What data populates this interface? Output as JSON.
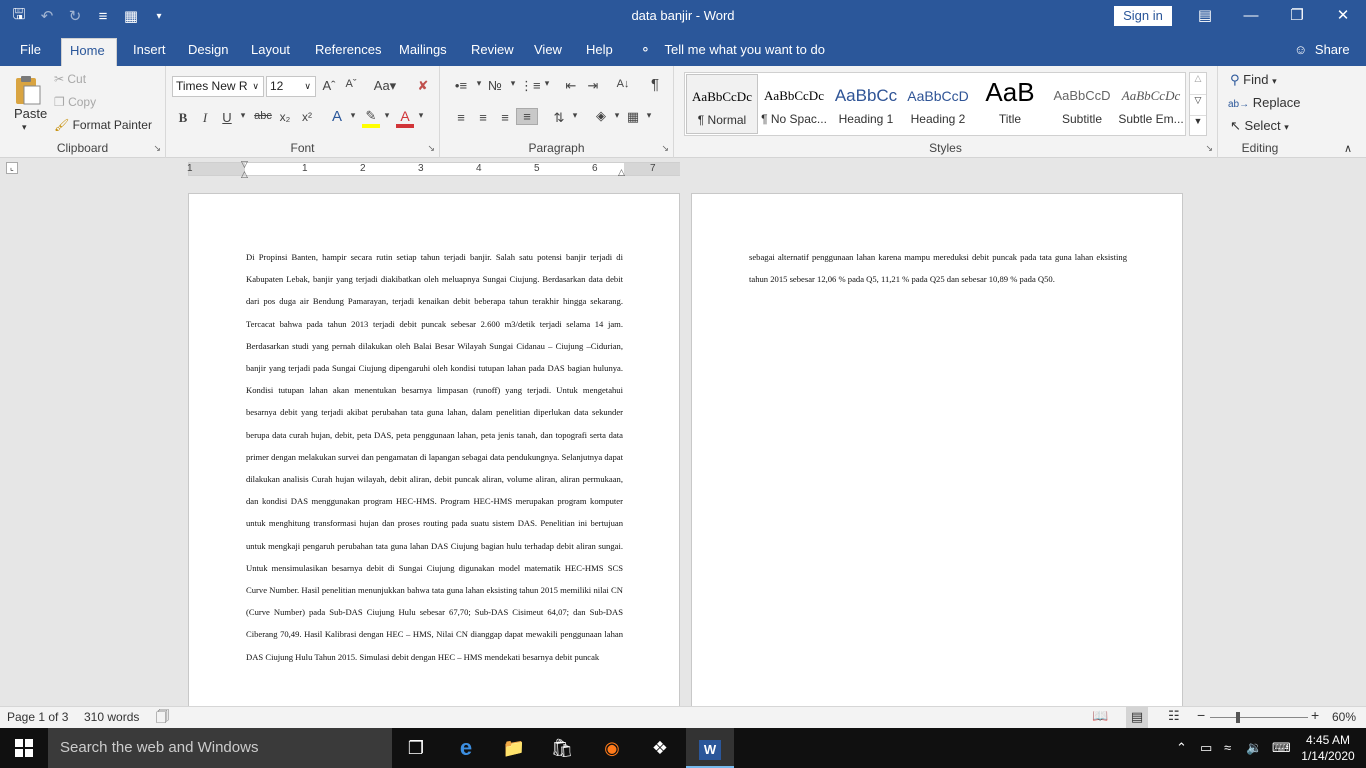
{
  "window": {
    "title": "data banjir  -  Word",
    "sign_in": "Sign in"
  },
  "ribbon_tabs": [
    "File",
    "Home",
    "Insert",
    "Design",
    "Layout",
    "References",
    "Mailings",
    "Review",
    "View",
    "Help"
  ],
  "tell_me": "Tell me what you want to do",
  "share": "Share",
  "clipboard": {
    "paste": "Paste",
    "cut": "Cut",
    "copy": "Copy",
    "format_painter": "Format Painter",
    "label": "Clipboard"
  },
  "font": {
    "name": "Times New R",
    "size": "12",
    "label": "Font"
  },
  "paragraph": {
    "label": "Paragraph"
  },
  "styles": {
    "label": "Styles",
    "items": [
      {
        "preview": "AaBbCcDc",
        "name": "¶ Normal"
      },
      {
        "preview": "AaBbCcDc",
        "name": "¶ No Spac..."
      },
      {
        "preview": "AaBbCc",
        "name": "Heading 1"
      },
      {
        "preview": "AaBbCcD",
        "name": "Heading 2"
      },
      {
        "preview": "AaB",
        "name": "Title"
      },
      {
        "preview": "AaBbCcD",
        "name": "Subtitle"
      },
      {
        "preview": "AaBbCcDc",
        "name": "Subtle Em..."
      }
    ]
  },
  "editing": {
    "find": "Find",
    "replace": "Replace",
    "select": "Select",
    "label": "Editing"
  },
  "ruler_numbers": [
    "1",
    "1",
    "2",
    "3",
    "4",
    "5",
    "6",
    "7"
  ],
  "document": {
    "page1_text": "Di Propinsi Banten, hampir secara rutin setiap tahun terjadi banjir. Salah satu potensi banjir terjadi di Kabupaten Lebak, banjir yang terjadi diakibatkan oleh meluapnya Sungai Ciujung. Berdasarkan data debit dari pos duga air Bendung Pamarayan, terjadi kenaikan debit beberapa tahun terakhir hingga sekarang. Tercacat bahwa pada tahun 2013 terjadi debit puncak sebesar 2.600 m3/detik terjadi selama 14 jam. Berdasarkan studi yang pernah dilakukan oleh Balai Besar Wilayah Sungai Cidanau – Ciujung –Cidurian, banjir yang terjadi pada Sungai Ciujung dipengaruhi oleh kondisi tutupan lahan pada DAS bagian hulunya. Kondisi tutupan lahan akan menentukan besarnya limpasan (runoff) yang terjadi.  Untuk mengetahui besarnya debit yang terjadi akibat perubahan tata guna lahan, dalam penelitian diperlukan data sekunder berupa data curah hujan, debit, peta DAS, peta penggunaan lahan, peta jenis tanah, dan topografi serta data primer dengan melakukan survei dan pengamatan di lapangan sebagai data pendukungnya. Selanjutnya dapat dilakukan analisis Curah hujan wilayah, debit aliran, debit puncak aliran, volume aliran, aliran permukaan, dan kondisi DAS menggunakan program HEC-HMS. Program HEC-HMS merupakan program komputer untuk menghitung transformasi hujan dan proses routing pada suatu sistem DAS. Penelitian ini bertujuan untuk mengkaji pengaruh perubahan tata guna lahan DAS Ciujung bagian hulu terhadap debit aliran sungai. Untuk mensimulasikan besarnya debit di Sungai Ciujung digunakan model matematik HEC-HMS SCS Curve Number. Hasil penelitian menunjukkan bahwa tata guna lahan eksisting tahun 2015 memiliki nilai CN (Curve Number) pada Sub-DAS Ciujung Hulu sebesar 67,70; Sub-DAS Cisimeut 64,07; dan Sub-DAS Ciberang 70,49. Hasil Kalibrasi dengan HEC – HMS, Nilai CN dianggap dapat mewakili penggunaan lahan DAS Ciujung Hulu Tahun 2015. Simulasi debit dengan HEC – HMS mendekati besarnya debit puncak",
    "page2_text": "sebagai alternatif penggunaan lahan karena mampu mereduksi debit puncak pada tata guna lahan eksisting tahun 2015 sebesar 12,06 % pada Q5, 11,21 % pada Q25 dan sebesar 10,89 % pada Q50."
  },
  "status": {
    "page": "Page 1 of 3",
    "words": "310 words",
    "zoom": "60%"
  },
  "taskbar": {
    "search_placeholder": "Search the web and Windows",
    "time": "4:45 AM",
    "date": "1/14/2020"
  },
  "colors": {
    "word_blue": "#2b579a",
    "ribbon_bg": "#f3f3f3",
    "canvas_bg": "#e6e6e6",
    "taskbar_bg": "#101010",
    "font_red": "#d13438",
    "highlight_yellow": "#ffff00"
  }
}
